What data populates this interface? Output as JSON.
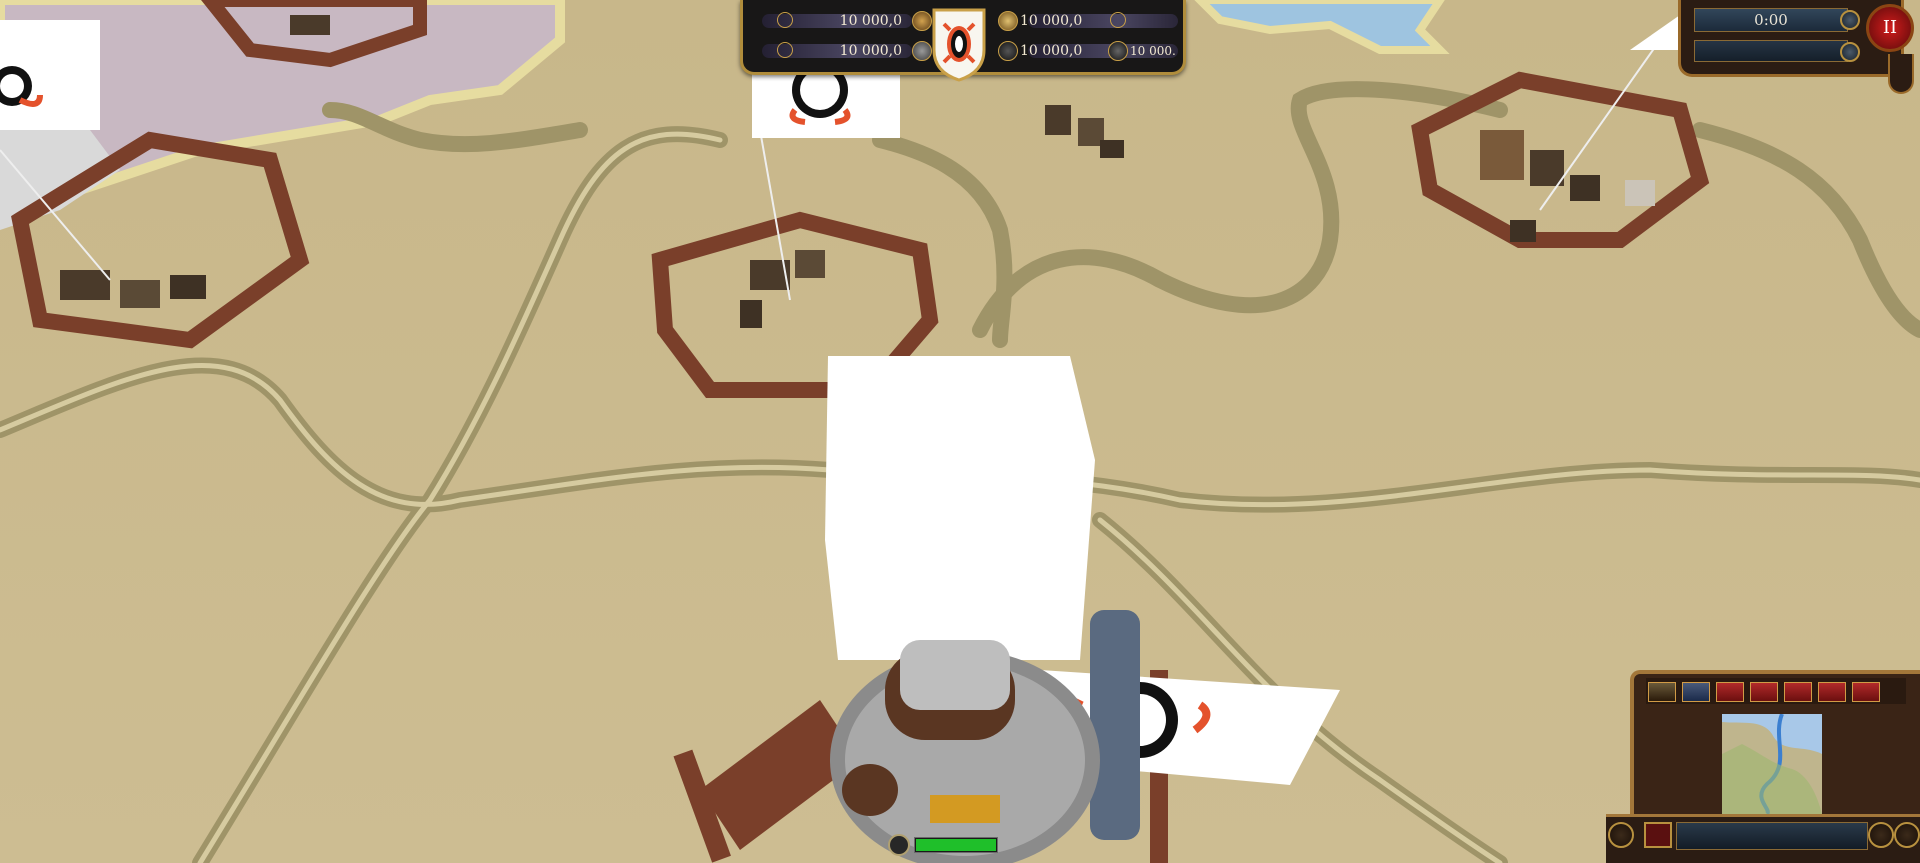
{
  "resources": {
    "top_left": {
      "value": "10 000,0",
      "icon": "wood-icon"
    },
    "bottom_left": {
      "value": "10 000,0",
      "icon": "iron-icon"
    },
    "top_right": {
      "value": "10 000,0",
      "icon": "bread-icon"
    },
    "bottom_right": {
      "value": "10 000,0",
      "icon": "people-icon"
    },
    "population": {
      "value": "10 000.",
      "icon": "wheel-icon"
    }
  },
  "clock": {
    "time": "0:00",
    "pause_label": "II"
  },
  "unit": {
    "health_fraction": 1.0
  },
  "colors": {
    "ui_gold": "#b08d3c",
    "ui_dark": "#181717",
    "ground": "#c9b98c",
    "road": "#a59a6f",
    "palisade": "#7a3f2a",
    "banner_red": "#e4522c",
    "health_green": "#1fbf2a"
  },
  "minimap": {
    "tab_count": 5
  }
}
